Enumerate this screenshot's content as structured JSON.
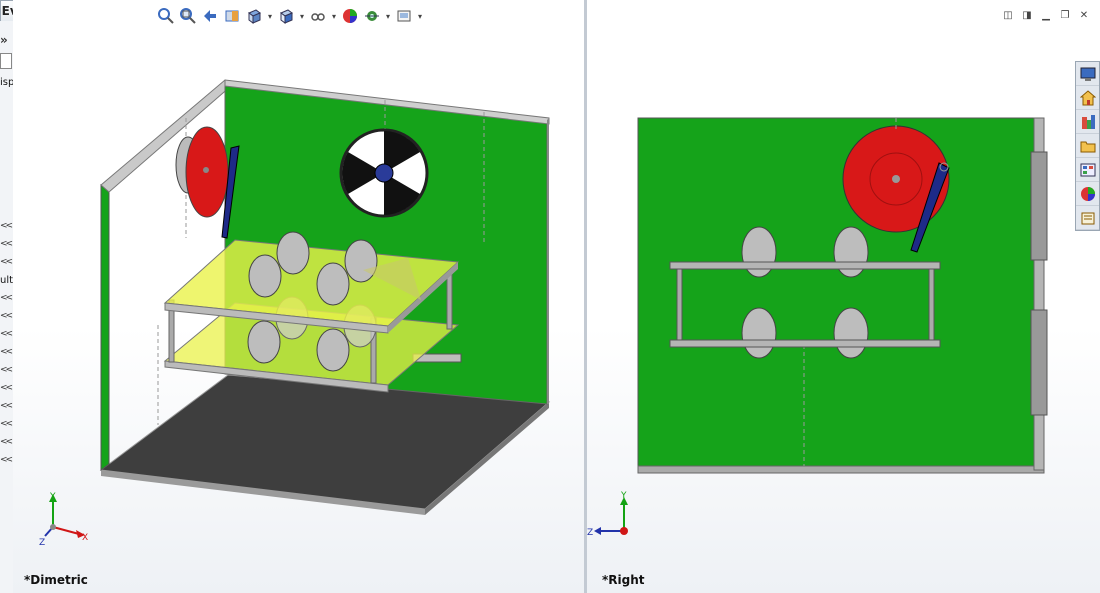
{
  "tab": {
    "label": "Evaluate"
  },
  "left_panel": {
    "expand": "»",
    "snippet_display": "isp",
    "snippet_result": "ult",
    "arrow": "<<"
  },
  "views": {
    "left": {
      "label": "*Dimetric"
    },
    "right": {
      "label": "*Right"
    }
  },
  "triad": {
    "x": "X",
    "y": "Y",
    "z": "Z"
  },
  "heads_up_toolbar": [
    "zoom-to-fit",
    "zoom-to-area",
    "previous-view",
    "section-view",
    "view-orientation",
    "display-style",
    "hide-show-items",
    "edit-appearance",
    "apply-scene",
    "view-settings"
  ],
  "task_pane": [
    "solidworks-resources",
    "design-library",
    "file-explorer",
    "view-palette",
    "appearances",
    "custom-properties"
  ],
  "colors": {
    "green_wall": "#15a31a",
    "floor": "#3e3e3e",
    "tray": "#eaf24a",
    "red_disc": "#d81818",
    "blue_arm": "#1e2a88",
    "frame": "#a9a9a9"
  }
}
